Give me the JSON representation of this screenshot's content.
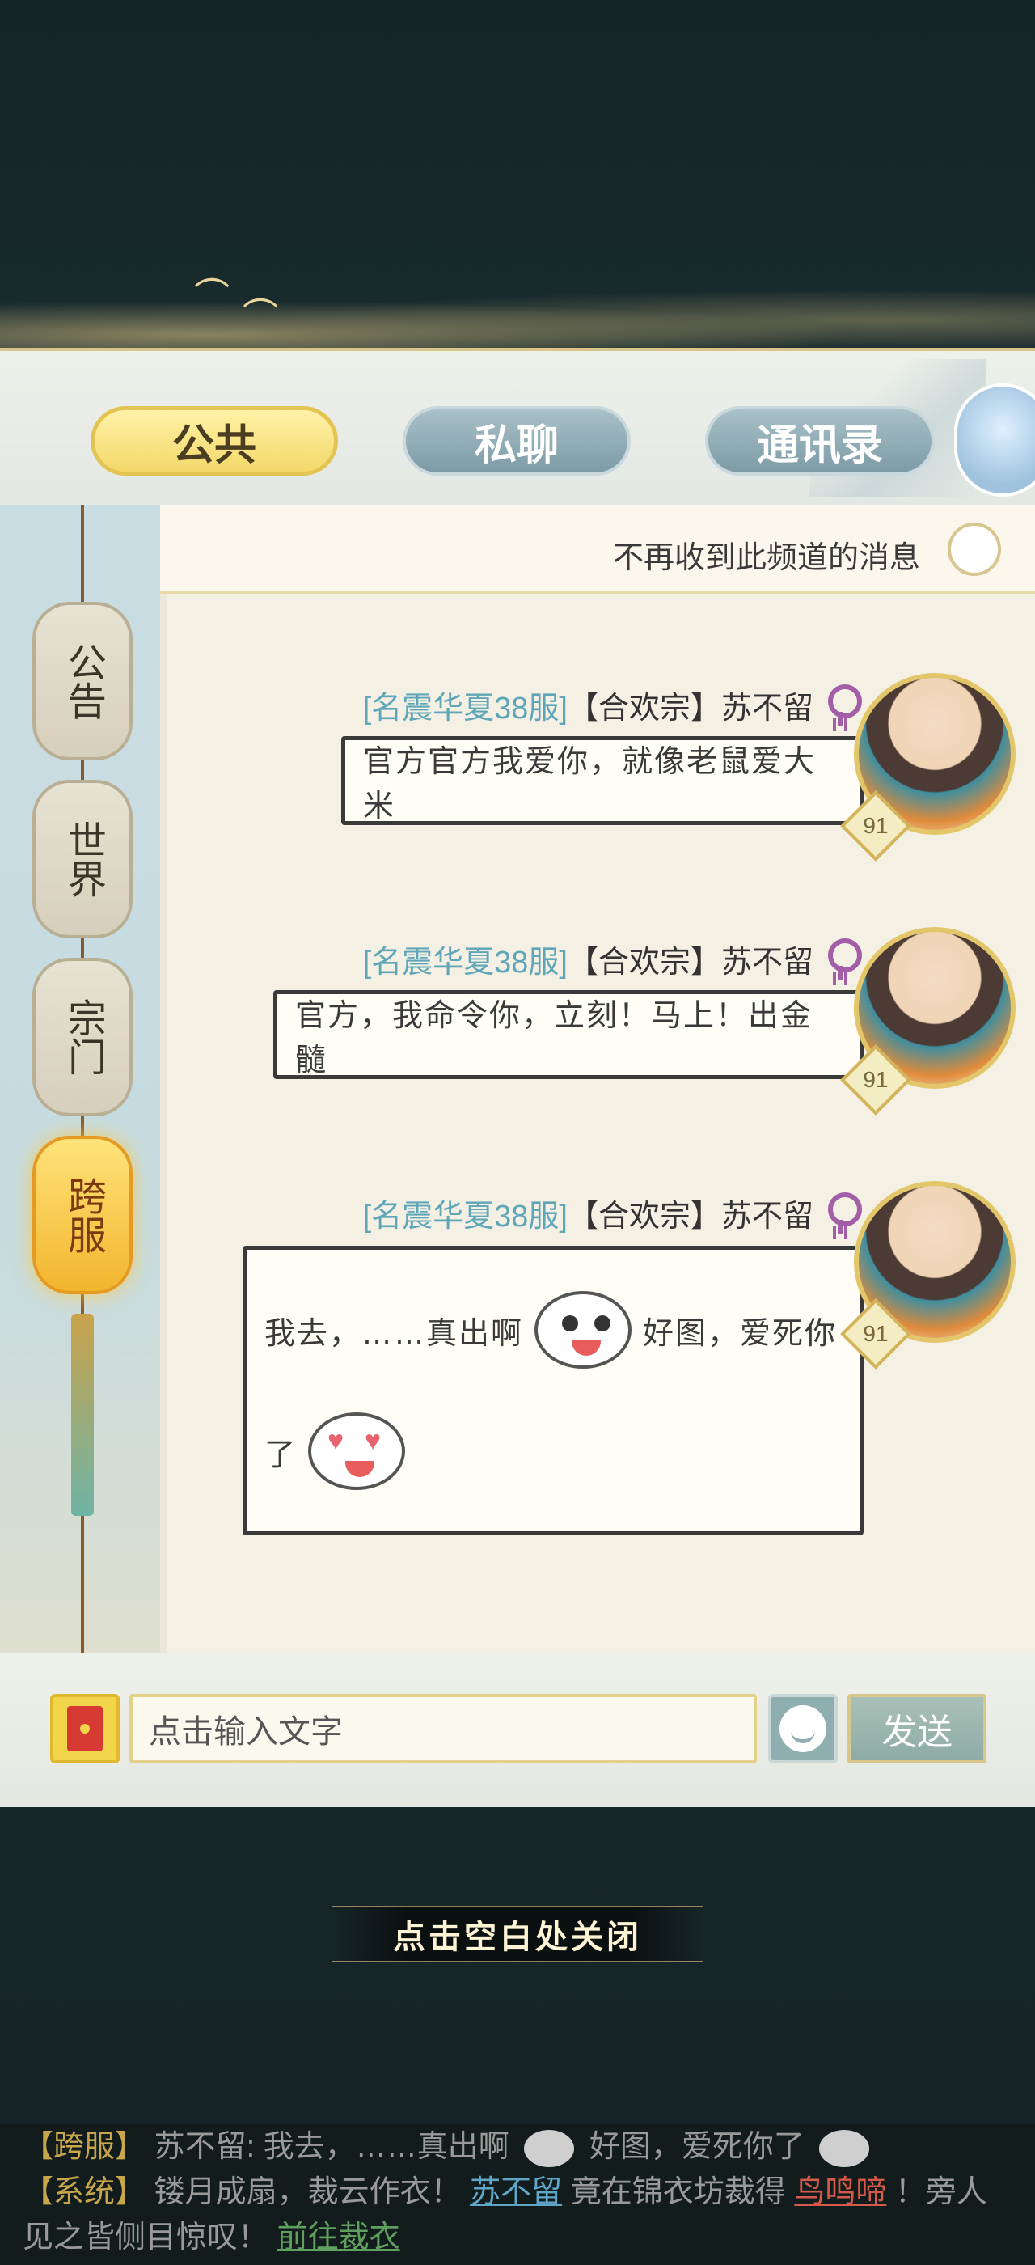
{
  "tabs": {
    "public": "公共",
    "private": "私聊",
    "contacts": "通讯录"
  },
  "side_channels": [
    {
      "label": "公告",
      "active": false
    },
    {
      "label": "世界",
      "active": false
    },
    {
      "label": "宗门",
      "active": false
    },
    {
      "label": "跨服",
      "active": true
    }
  ],
  "notice": {
    "text": "不再收到此频道的消息",
    "toggle_on": false
  },
  "messages": [
    {
      "server": "[名震华夏38服]",
      "sect": "【合欢宗】",
      "name": "苏不留",
      "level": "91",
      "text": "官方官方我爱你，就像老鼠爱大米"
    },
    {
      "server": "[名震华夏38服]",
      "sect": "【合欢宗】",
      "name": "苏不留",
      "level": "91",
      "text": "官方，我命令你，立刻！马上！出金髓"
    },
    {
      "server": "[名震华夏38服]",
      "sect": "【合欢宗】",
      "name": "苏不留",
      "level": "91",
      "text_part1": "我去，……真出啊",
      "text_part2": "好图，爱死你",
      "text_part3": "了",
      "emojis": [
        "surprised-emoji",
        "heart-eyes-emoji"
      ]
    }
  ],
  "input": {
    "placeholder": "点击输入文字",
    "send_label": "发送"
  },
  "close_hint": "点击空白处关闭",
  "ticker": {
    "line1_tag": "【跨服】",
    "line1_name": "苏不留:",
    "line1_text1": "我去，……真出啊",
    "line1_text2": "好图，爱死你了",
    "line2_tag": "【系统】",
    "line2_text1": "镂月成扇，裁云作衣！",
    "line2_player": "苏不留",
    "line2_text2": "竟在锦衣坊裁得",
    "line2_item": "鸟鸣啼",
    "line2_text3": "！旁人见之皆侧目惊叹！",
    "line2_link": "前往裁衣"
  },
  "colors": {
    "server_tag": "#5fa6b9",
    "female_icon": "#a25fa8",
    "active_tab": "#f3d86a",
    "inactive_tab": "#7d9ba6",
    "active_lantern": "#f2b52e"
  }
}
